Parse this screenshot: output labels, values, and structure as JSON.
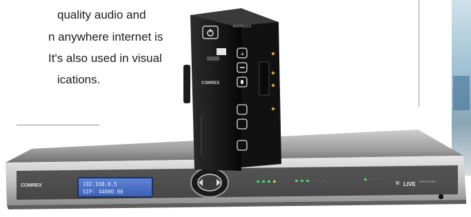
{
  "article": {
    "lines": [
      "...",
      "quality audio and",
      "n anywhere internet is",
      "It's also used in visual",
      "ications."
    ]
  },
  "portable_unit": {
    "model_label": "EXPRESS",
    "brand_label": "COMREX"
  },
  "rack_unit": {
    "brand_label": "COMREX",
    "lcd_line_1": "192.168.0.5",
    "lcd_line_2": "SIP: 44000.00",
    "live_label": "LIVE"
  }
}
